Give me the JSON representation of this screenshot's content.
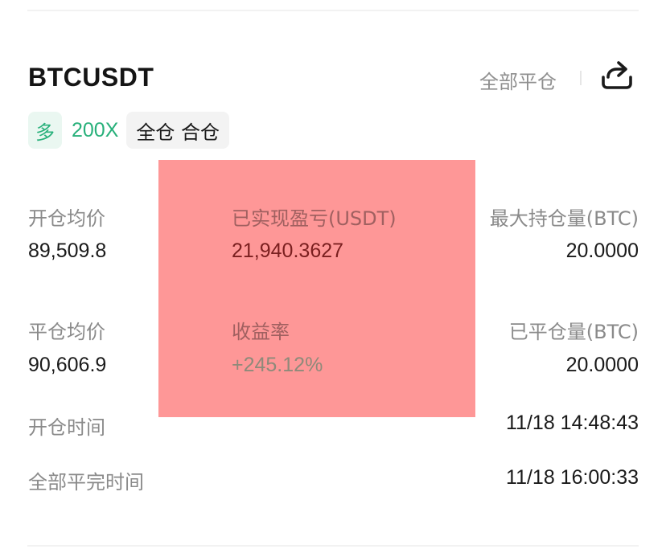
{
  "header": {
    "symbol": "BTCUSDT",
    "close_all_label": "全部平仓"
  },
  "icons": {
    "share": "share-icon"
  },
  "tags": {
    "side": "多",
    "leverage": "200X",
    "margin_mode": "全仓 合仓"
  },
  "stats": {
    "open_avg_label": "开仓均价",
    "open_avg_value": "89,509.8",
    "realized_pnl_label": "已实现盈亏(USDT)",
    "realized_pnl_value": "21,940.3627",
    "max_position_label": "最大持仓量(BTC)",
    "max_position_value": "20.0000",
    "close_avg_label": "平仓均价",
    "close_avg_value": "90,606.9",
    "return_rate_label": "收益率",
    "return_rate_value": "+245.12%",
    "closed_qty_label": "已平仓量(BTC)",
    "closed_qty_value": "20.0000",
    "open_time_label": "开仓时间",
    "open_time_value": "11/18 14:48:43",
    "close_all_time_label": "全部平完时间",
    "close_all_time_value": "11/18 16:00:33"
  },
  "colors": {
    "long_green": "#27b07a",
    "redaction_overlay": "#fe9797"
  }
}
